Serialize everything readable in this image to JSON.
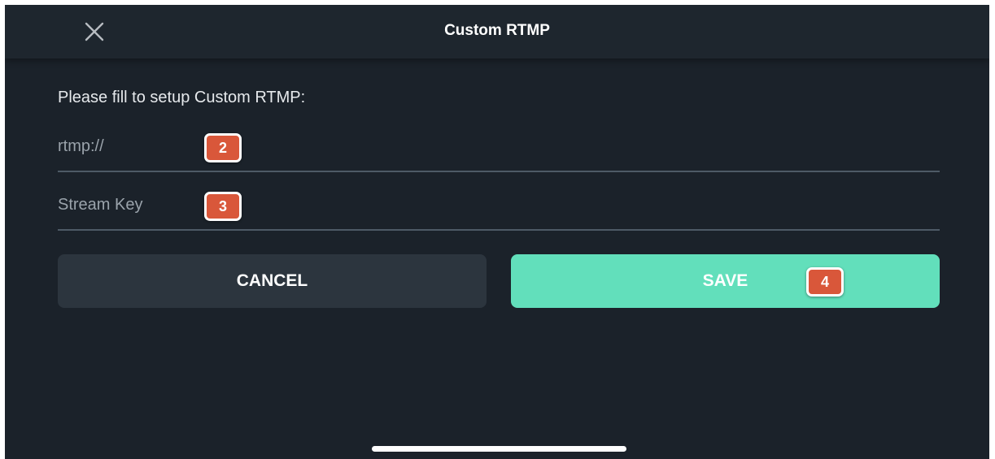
{
  "header": {
    "title": "Custom RTMP",
    "close_icon": "close-icon"
  },
  "form": {
    "prompt": "Please fill to setup Custom RTMP:",
    "url_field": {
      "placeholder": "rtmp://",
      "value": "",
      "badge": "2"
    },
    "stream_key_field": {
      "placeholder": "Stream Key",
      "value": "",
      "badge": "3"
    }
  },
  "actions": {
    "cancel_label": "CANCEL",
    "save_label": "SAVE",
    "save_badge": "4"
  },
  "colors": {
    "background": "#1b222a",
    "save_button": "#62dfbb",
    "cancel_button": "#2c353e",
    "badge": "#d9573a"
  }
}
